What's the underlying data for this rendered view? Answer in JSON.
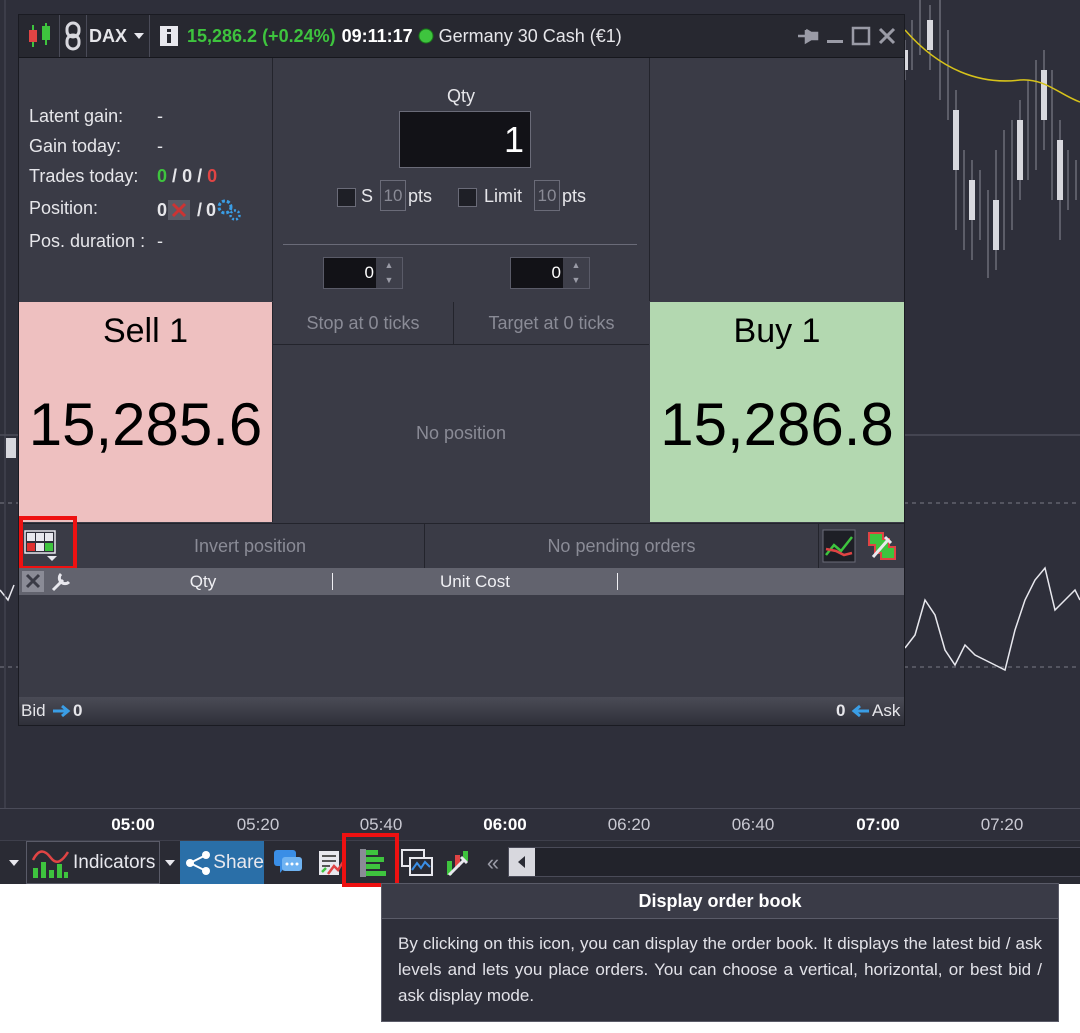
{
  "window": {
    "symbol": "DAX",
    "price_change": "15,286.2 (+0.24%)",
    "time": "09:11:17",
    "instrument_name": "Germany 30 Cash (€1)"
  },
  "stats": {
    "latent_gain_label": "Latent gain:",
    "latent_gain_value": "-",
    "gain_today_label": "Gain today:",
    "gain_today_value": "-",
    "trades_today_label": "Trades today:",
    "trades_today_won": "0",
    "trades_today_sep1": "/",
    "trades_today_even": "0",
    "trades_today_sep2": "/",
    "trades_today_lost": "0",
    "position_label": "Position:",
    "position_value_left": "0",
    "position_sep": "/",
    "position_value_right": "0",
    "pos_duration_label": "Pos. duration :",
    "pos_duration_value": "-"
  },
  "order": {
    "qty_label": "Qty",
    "qty_value": "1",
    "stop_label": "S",
    "stop_pts_value": "10",
    "stop_unit": "pts",
    "limit_label": "Limit",
    "limit_pts_value": "10",
    "limit_unit": "pts",
    "stop_spinner_value": "0",
    "target_spinner_value": "0"
  },
  "sell": {
    "title": "Sell 1",
    "price": "15,285.6"
  },
  "buy": {
    "title": "Buy 1",
    "price": "15,286.8"
  },
  "mid": {
    "stop_tab": "Stop at 0 ticks",
    "target_tab": "Target at 0 ticks",
    "position_status": "No position"
  },
  "actions": {
    "invert_position": "Invert position",
    "pending_orders": "No pending orders"
  },
  "table": {
    "columns": [
      "Qty",
      "Unit Cost"
    ],
    "bid_label": "Bid",
    "bid_value": "0",
    "ask_value": "0",
    "ask_label": "Ask"
  },
  "time_axis": [
    "05:00",
    "05:20",
    "05:40",
    "06:00",
    "06:20",
    "06:40",
    "07:00",
    "07:20"
  ],
  "toolbar": {
    "indicators_label": "Indicators",
    "share_label": "Share",
    "collapse_glyph": "«"
  },
  "tooltip": {
    "title": "Display order book",
    "body": "By clicking on this icon, you can display the order book. It displays the latest bid / ask levels and lets you place orders. You can choose a vertical, horizontal, or best bid / ask display mode."
  },
  "colors": {
    "highlight": "#ee1111",
    "sell_bg": "#eec0c0",
    "buy_bg": "#b3d8b0",
    "positive": "#3ec43e",
    "negative": "#e04444",
    "share_bg": "#2a6fa8"
  }
}
